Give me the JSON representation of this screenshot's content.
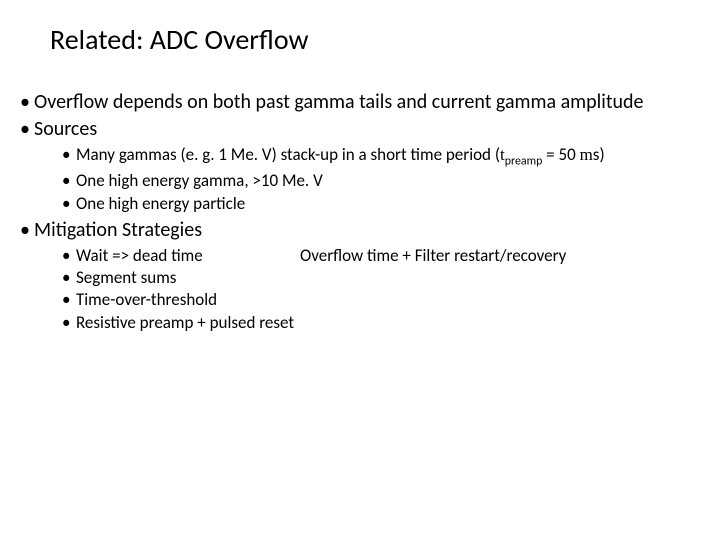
{
  "title": "Related: ADC Overflow",
  "bullets": {
    "l1_0": "Overflow depends on both past gamma tails and current gamma amplitude",
    "l1_1": "Sources",
    "l1_1_sub": {
      "s0_pre": "Many gammas (e. g. 1 Me. V) stack-up in a short time period (",
      "s0_tau": "t",
      "s0_sub": "preamp",
      "s0_mid": " = 50 ",
      "s0_mu": "m",
      "s0_post": "s)",
      "s1": "One high energy gamma, >10 Me. V",
      "s2": "One high energy particle"
    },
    "l1_2": "Mitigation Strategies",
    "l1_2_sub": {
      "s0_left": "Wait => dead time",
      "s0_right": "Overflow time + Filter restart/recovery",
      "s1": "Segment sums",
      "s2": "Time-over-threshold",
      "s3": "Resistive preamp + pulsed reset"
    }
  }
}
